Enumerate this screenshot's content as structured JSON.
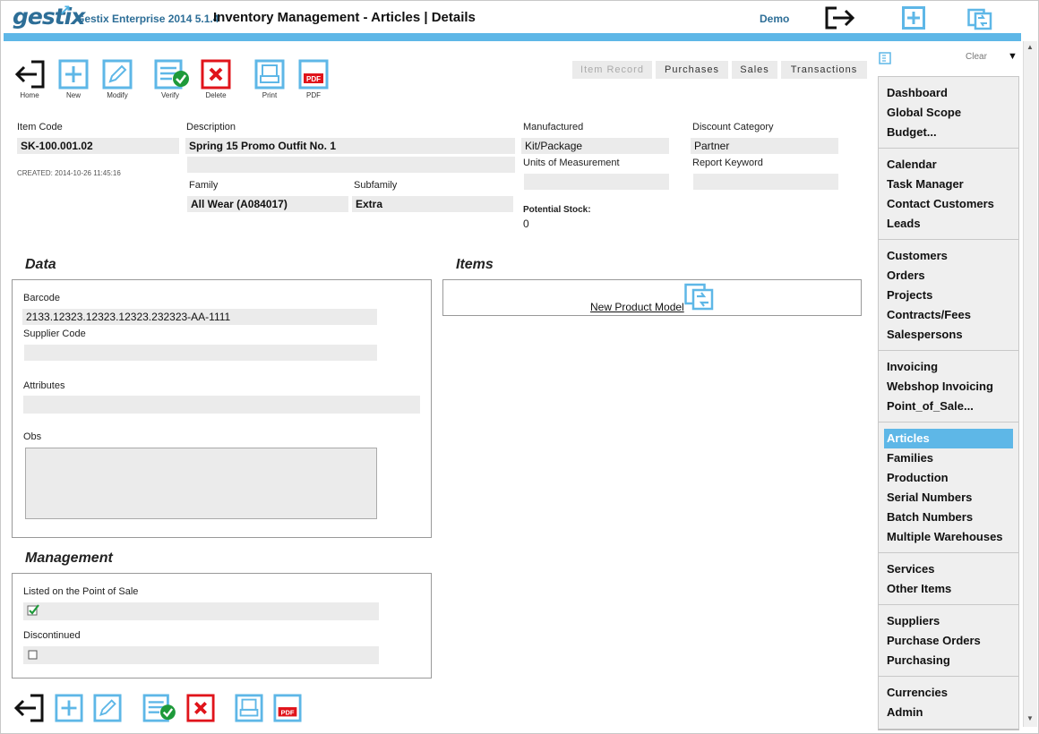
{
  "header": {
    "logo": "gestix",
    "app_version": "Gestix Enterprise 2014 5.1.4",
    "page_title": "Inventory Management - Articles | Details",
    "user": "Demo"
  },
  "toolbar": {
    "home": "Home",
    "new": "New",
    "modify": "Modify",
    "verify": "Verify",
    "delete": "Delete",
    "print": "Print",
    "pdf": "PDF",
    "pdf_badge": "PDF"
  },
  "tabs": [
    "Item Record",
    "Purchases",
    "Sales",
    "Transactions"
  ],
  "item": {
    "code_label": "Item Code",
    "code": "SK-100.001.02",
    "created": "CREATED: 2014-10-26 11:45:16",
    "description_label": "Description",
    "description": "Spring 15 Promo Outfit No. 1",
    "description2": "",
    "family_label": "Family",
    "family": "All Wear (A084017)",
    "subfamily_label": "Subfamily",
    "subfamily": "Extra",
    "manufactured_label": "Manufactured",
    "manufactured": "Kit/Package",
    "units_label": "Units of Measurement",
    "units": "",
    "discount_label": "Discount Category",
    "discount": "Partner",
    "report_label": "Report Keyword",
    "report": "",
    "potential_label": "Potential Stock:",
    "potential": "0"
  },
  "data_section": {
    "title": "Data",
    "barcode_label": "Barcode",
    "barcode": "2133.12323.12323.12323.232323-AA-1111",
    "supplier_label": "Supplier Code",
    "supplier": "",
    "attributes_label": "Attributes",
    "attributes": "",
    "obs_label": "Obs",
    "obs": ""
  },
  "items_section": {
    "title": "Items",
    "new_model": "New Product Model"
  },
  "management": {
    "title": "Management",
    "pos_label": "Listed on the Point of Sale",
    "pos_checked": true,
    "discontinued_label": "Discontinued",
    "discontinued_checked": false
  },
  "sidebar": {
    "clear": "Clear",
    "groups": [
      [
        "Dashboard",
        "Global Scope",
        "Budget..."
      ],
      [
        "Calendar",
        "Task Manager",
        "Contact Customers",
        "Leads"
      ],
      [
        "Customers",
        "Orders",
        "Projects",
        "Contracts/Fees",
        "Salespersons"
      ],
      [
        "Invoicing",
        "Webshop Invoicing",
        "Point_of_Sale..."
      ],
      [
        "Articles",
        "Families",
        "Production",
        "Serial Numbers",
        "Batch Numbers",
        "Multiple Warehouses"
      ],
      [
        "Services",
        "Other Items"
      ],
      [
        "Suppliers",
        "Purchase Orders",
        "Purchasing"
      ],
      [
        "Currencies",
        "Admin"
      ]
    ],
    "active": "Articles"
  },
  "colors": {
    "accent": "#5eb7e7",
    "brand": "#2d6e97",
    "field_bg": "#ebebeb",
    "delete_red": "#e0141b",
    "verify_green": "#1e9a3a"
  }
}
